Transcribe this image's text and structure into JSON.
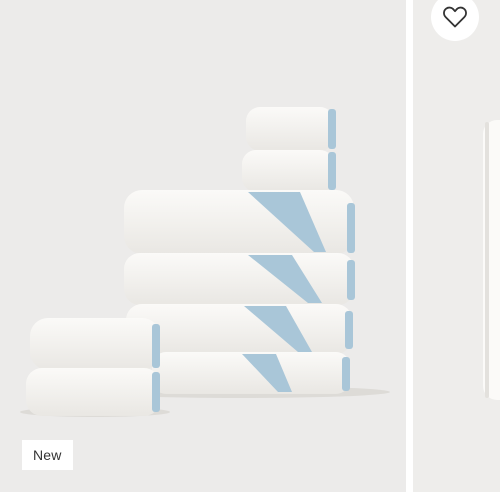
{
  "product_card": {
    "badge": "New",
    "image_icon": "folded-towel-stack-image"
  },
  "next_card": {
    "wishlist_icon": "heart-outline-icon",
    "image_icon": "rolled-towel-image"
  },
  "colors": {
    "card_background": "#ecebea",
    "towel": "#f8f7f4",
    "trim": "#a9c6d8"
  }
}
